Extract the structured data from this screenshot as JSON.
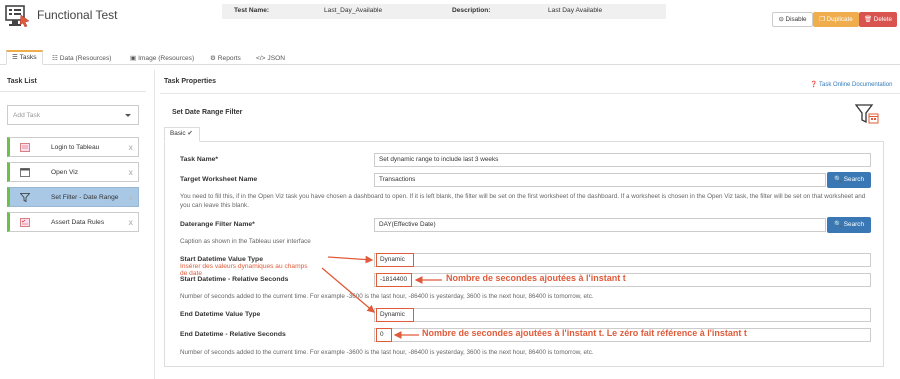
{
  "app": {
    "title": "Functional Test"
  },
  "info_bar": {
    "test_name_label": "Test Name:",
    "test_name": "Last_Day_Available",
    "description_label": "Description:",
    "description": "Last Day Available"
  },
  "actions": {
    "disable": "Disable",
    "duplicate": "Duplicate",
    "delete": "Delete"
  },
  "tabs": [
    {
      "label": "Tasks",
      "icon": "tasks-icon"
    },
    {
      "label": "Data (Resources)",
      "icon": "list-icon"
    },
    {
      "label": "Image (Resources)",
      "icon": "image-icon"
    },
    {
      "label": "Reports",
      "icon": "gear-icon"
    },
    {
      "label": "JSON",
      "icon": "code-icon"
    }
  ],
  "task_list": {
    "title": "Task List",
    "add_placeholder": "Add Task",
    "items": [
      {
        "label": "Login to Tableau",
        "icon": "login-icon"
      },
      {
        "label": "Open Viz",
        "icon": "window-icon"
      },
      {
        "label": "Set Filter - Date Range",
        "icon": "filter-icon"
      },
      {
        "label": "Assert Data Rules",
        "icon": "checklist-icon"
      }
    ],
    "remove_glyph": "x"
  },
  "properties": {
    "title": "Task Properties",
    "online_doc": "Task Online Documentation",
    "filter_title": "Set Date Range Filter",
    "subtab": "Basic",
    "subtab_check": "✔",
    "task_name_label": "Task Name*",
    "task_name_value": "Set dynamic range to include last 3 weeks",
    "target_ws_label": "Target Worksheet Name",
    "target_ws_value": "Transactions",
    "search_label": "Search",
    "target_ws_help": "You need to fill this, if in the Open Viz task you have chosen a dashboard to open. If it is left blank, the filter will be set on the first worksheet of the dashboard. If a worksheet is chosen in the Open Viz task, the filter will be set on that worksheet and you can leave this blank.",
    "daterange_label": "Daterange Filter Name*",
    "daterange_value": "DAY(Effective Date)",
    "daterange_help": "Caption as shown in the Tableau user interface",
    "start_type_label": "Start Datetime Value Type",
    "start_type_value": "Dynamic",
    "start_rel_label": "Start Datetime - Relative Seconds",
    "start_rel_value": "-1814400",
    "start_help": "Number of seconds added to the current time. For example -3600 is the last hour, -86400 is yesterday, 3600 is the next hour, 86400 is tomorrow, etc.",
    "end_type_label": "End Datetime Value Type",
    "end_type_value": "Dynamic",
    "end_rel_label": "End Datetime - Relative Seconds",
    "end_rel_value": "0",
    "end_help": "Number of seconds added to the current time. For example -3600 is the last hour, -86400 is yesterday, 3600 is the next hour, 86400 is tomorrow, etc."
  },
  "annotations": {
    "dynamic_note": "Insérer des valeurs dynamiques au champs de date",
    "start_note": "Nombre de secondes ajoutées à l'instant t",
    "end_note": "Nombre de secondes ajoutées à l'instant t. Le zéro fait référence à l'instant t",
    "color": "#e05b3a"
  },
  "colors": {
    "accent": "#f0ad4e",
    "danger": "#d9534f",
    "primary": "#3a78b5",
    "success": "#6cc04a",
    "active_item": "#a9c8e6"
  }
}
